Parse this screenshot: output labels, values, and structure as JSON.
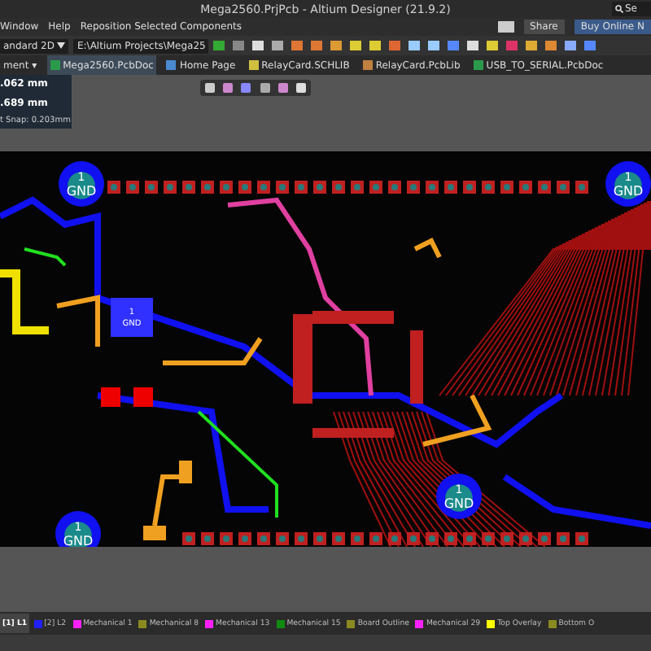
{
  "window": {
    "title": "Mega2560.PrjPcb - Altium Designer (21.9.2)",
    "search": "Se"
  },
  "menu": {
    "items": [
      "Window",
      "Help",
      "Reposition Selected Components"
    ],
    "share": "Share",
    "buy": "Buy Online N"
  },
  "toolbar": {
    "view": "andard 2D",
    "path": "E:\\Altium Projects\\Mega25"
  },
  "tabs": [
    {
      "label": "ment ▾",
      "kind": "panel",
      "selected": false
    },
    {
      "label": "Mega2560.PcbDoc",
      "kind": "pcb",
      "selected": true
    },
    {
      "label": "Home Page",
      "kind": "home",
      "selected": false
    },
    {
      "label": "RelayCard.SCHLIB",
      "kind": "sch",
      "selected": false
    },
    {
      "label": "RelayCard.PcbLib",
      "kind": "lib",
      "selected": false
    },
    {
      "label": "USB_TO_SERIAL.PcbDoc",
      "kind": "pcb",
      "selected": false
    }
  ],
  "readout": {
    "lines": [
      ".062 mm",
      ".689 mm"
    ],
    "snap": "t Snap: 0.203mm"
  },
  "board": {
    "gnd_pads": [
      {
        "number": "1",
        "label": "GND"
      },
      {
        "number": "1",
        "label": "GND"
      },
      {
        "number": "1",
        "label": "GND"
      },
      {
        "number": "1",
        "label": "GND"
      },
      {
        "number": "1",
        "label": "GND"
      }
    ]
  },
  "layers": [
    {
      "label": "[1] L1",
      "selected": true
    },
    {
      "label": "[2] L2",
      "color": "#2020ff",
      "selected": false
    },
    {
      "label": "Mechanical 1",
      "color": "#ff20ff",
      "selected": false
    },
    {
      "label": "Mechanical 8",
      "color": "#8a8a20",
      "selected": false
    },
    {
      "label": "Mechanical 13",
      "color": "#ff20ff",
      "selected": false
    },
    {
      "label": "Mechanical 15",
      "color": "#108a10",
      "selected": false
    },
    {
      "label": "Board Outline",
      "color": "#8a8a20",
      "selected": false
    },
    {
      "label": "Mechanical 29",
      "color": "#ff20ff",
      "selected": false
    },
    {
      "label": "Top Overlay",
      "color": "#ffff00",
      "selected": false
    },
    {
      "label": "Bottom O",
      "color": "#8a8a20",
      "selected": false
    }
  ]
}
